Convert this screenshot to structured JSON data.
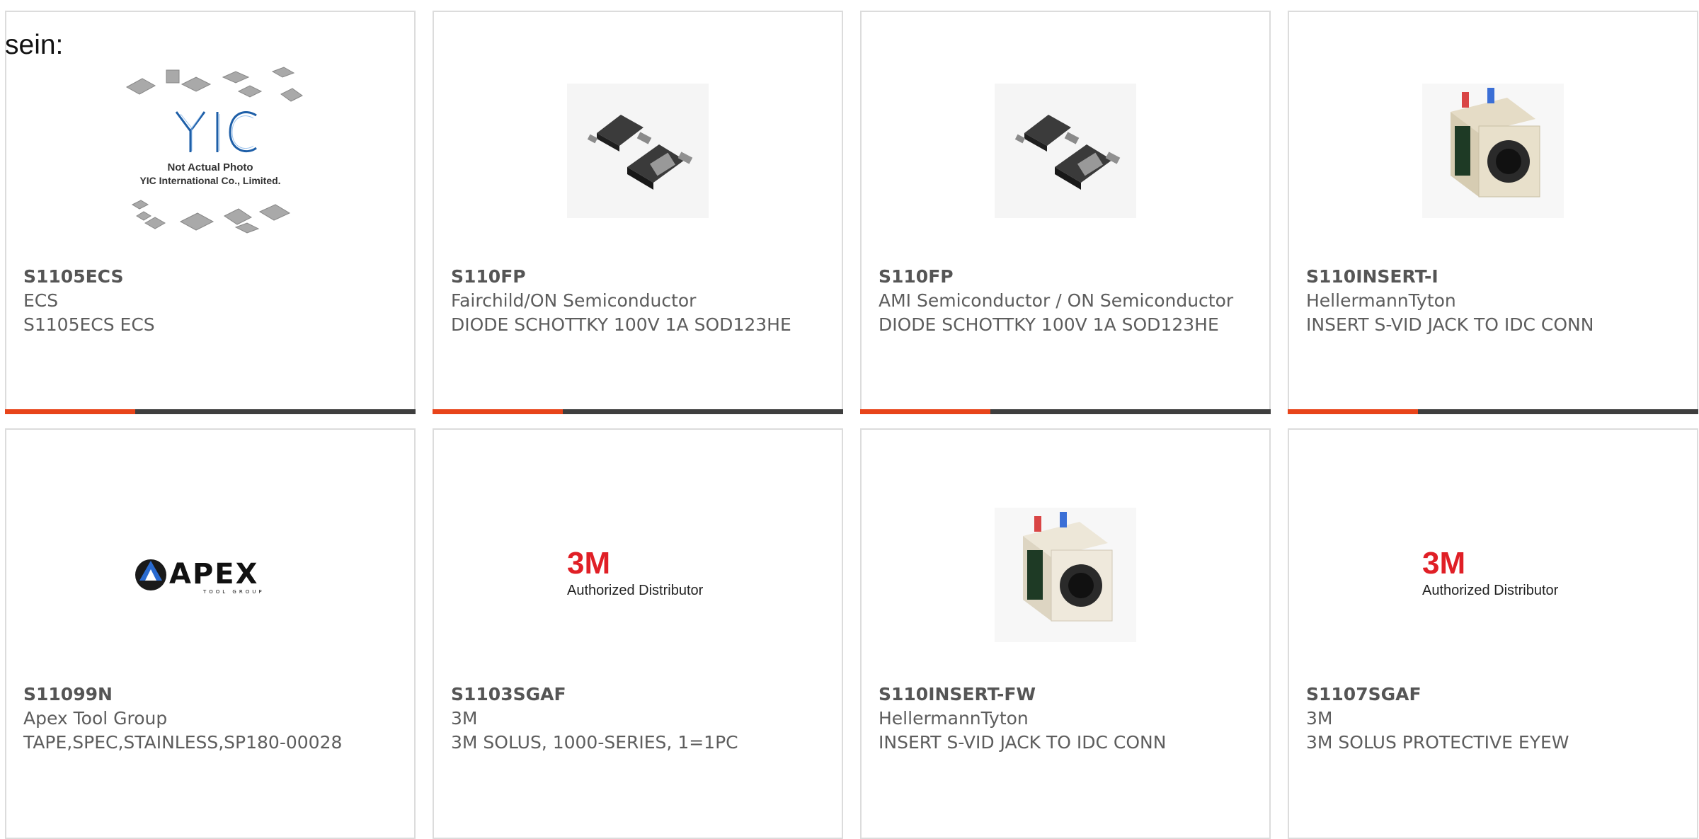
{
  "lead_text": "sein:",
  "colors": {
    "accent": "#e8441a",
    "bar": "#3e3e3e",
    "border": "#dcdcdc",
    "text": "#5d5d5d"
  },
  "products": [
    {
      "part": "S1105ECS",
      "maker": "ECS",
      "description": "S1105ECS ECS",
      "image": "yic-not-actual-photo",
      "image_text": [
        "Not Actual Photo",
        "YIC International Co., Limited."
      ],
      "logo_text": "YIC"
    },
    {
      "part": "S110FP",
      "maker": "Fairchild/ON Semiconductor",
      "description": "DIODE SCHOTTKY 100V 1A SOD123HE",
      "image": "sod123-diode-photo"
    },
    {
      "part": "S110FP",
      "maker": "AMI Semiconductor / ON Semiconductor",
      "description": "DIODE SCHOTTKY 100V 1A SOD123HE",
      "image": "sod123-diode-photo"
    },
    {
      "part": "S110INSERT-I",
      "maker": "HellermannTyton",
      "description": "INSERT S-VID JACK TO IDC CONN",
      "image": "svideo-jack-insert-photo"
    },
    {
      "part": "S11099N",
      "maker": "Apex Tool Group",
      "description": "TAPE,SPEC,STAINLESS,SP180-00028",
      "image": "apex-tool-group-logo",
      "logo_text": "APEX",
      "logo_subtext": "TOOL GROUP"
    },
    {
      "part": "S1103SGAF",
      "maker": "3M",
      "description": "3M SOLUS, 1000-SERIES, 1=1PC",
      "image": "3m-authorized-distributor-logo",
      "logo_text": "3M",
      "logo_subtext": "Authorized Distributor"
    },
    {
      "part": "S110INSERT-FW",
      "maker": "HellermannTyton",
      "description": "INSERT S-VID JACK TO IDC CONN",
      "image": "svideo-jack-insert-photo"
    },
    {
      "part": "S1107SGAF",
      "maker": "3M",
      "description": "3M SOLUS PROTECTIVE EYEW",
      "image": "3m-authorized-distributor-logo",
      "logo_text": "3M",
      "logo_subtext": "Authorized Distributor"
    }
  ]
}
